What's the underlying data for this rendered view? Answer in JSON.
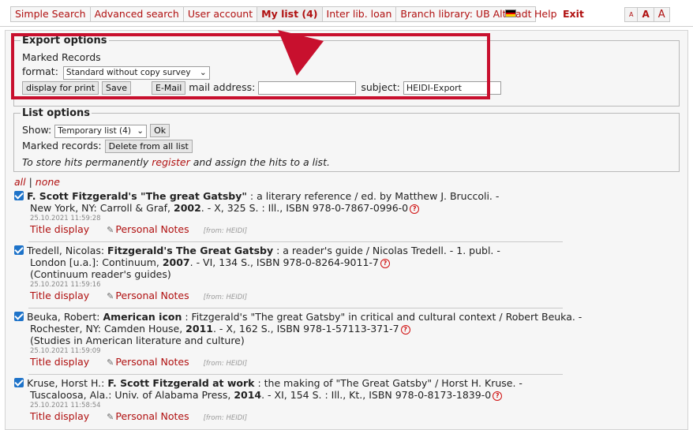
{
  "nav": {
    "items": [
      {
        "label": "Simple Search"
      },
      {
        "label": "Advanced search"
      },
      {
        "label": "User account"
      },
      {
        "label": "My list (4)"
      },
      {
        "label": "Inter lib. loan"
      },
      {
        "label": "Branch library: UB Altstadt"
      }
    ],
    "help": "Help",
    "exit": "Exit",
    "sizes": [
      "A",
      "A",
      "A"
    ],
    "flag_colors": [
      "#000000",
      "#dd0000",
      "#ffce00"
    ]
  },
  "export": {
    "legend": "Export options",
    "marked": "Marked Records",
    "format_label": "format:",
    "format_value": "Standard without copy survey",
    "print_btn": "display for print",
    "save_btn": "Save",
    "email_btn": "E-Mail",
    "mail_label": "mail address:",
    "mail_value": "",
    "subject_label": "subject:",
    "subject_value": "HEIDI-Export"
  },
  "list": {
    "legend": "List options",
    "show_label": "Show:",
    "show_value": "Temporary list (4)",
    "ok_btn": "Ok",
    "marked_label": "Marked records:",
    "delete_btn": "Delete from all list",
    "note_prefix": "To store hits permanently ",
    "note_link": "register",
    "note_suffix": " and assign the hits to a list."
  },
  "select": {
    "all": "all",
    "sep": " | ",
    "none": "none"
  },
  "records": [
    {
      "lead": "",
      "title": "F. Scott Fitzgerald's \"The great Gatsby\"",
      "rest": " : a literary reference / ed. by Matthew J. Bruccoli. -",
      "line2a": "New York, NY: Carroll & Graf, ",
      "year": "2002",
      "line2b": ". - X, 325 S. : Ill., ISBN 978-0-7867-0996-0",
      "series": "",
      "timestamp": "25.10.2021 11:59:28",
      "title_display": "Title display",
      "notes": "Personal Notes",
      "from": "[from: HEIDI]"
    },
    {
      "lead": "Tredell, Nicolas: ",
      "title": "Fitzgerald's The Great Gatsby",
      "rest": " : a reader's guide / Nicolas Tredell. - 1. publ. -",
      "line2a": "London [u.a.]: Continuum, ",
      "year": "2007",
      "line2b": ". - VI, 134 S., ISBN 978-0-8264-9011-7",
      "series": "(Continuum reader's guides)",
      "timestamp": "25.10.2021 11:59:16",
      "title_display": "Title display",
      "notes": "Personal Notes",
      "from": "[from: HEIDI]"
    },
    {
      "lead": "Beuka, Robert: ",
      "title": "American icon",
      "rest": " : Fitzgerald's \"The great Gatsby\" in critical and cultural context / Robert Beuka. -",
      "line2a": "Rochester, NY: Camden House, ",
      "year": "2011",
      "line2b": ". - X, 162 S., ISBN 978-1-57113-371-7",
      "series": "(Studies in American literature and culture)",
      "timestamp": "25.10.2021 11:59:09",
      "title_display": "Title display",
      "notes": "Personal Notes",
      "from": "[from: HEIDI]"
    },
    {
      "lead": "Kruse, Horst H.: ",
      "title": "F. Scott Fitzgerald at work",
      "rest": " : the making of \"The Great Gatsby\" / Horst H. Kruse. -",
      "line2a": "Tuscaloosa, Ala.: Univ. of Alabama Press, ",
      "year": "2014",
      "line2b": ". - XI, 154 S. : Ill., Kt., ISBN 978-0-8173-1839-0",
      "series": "",
      "timestamp": "25.10.2021 11:58:54",
      "title_display": "Title display",
      "notes": "Personal Notes",
      "from": "[from: HEIDI]"
    }
  ],
  "icons": {
    "info": "?",
    "clip": "✎"
  }
}
